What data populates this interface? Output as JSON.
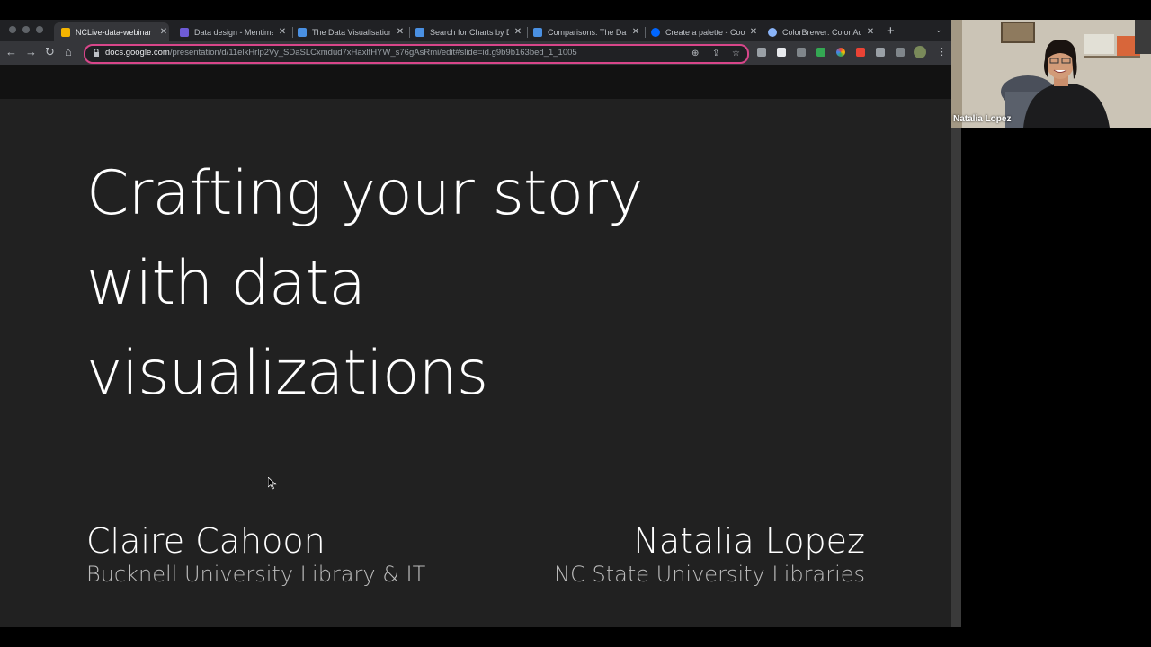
{
  "browser": {
    "tabs": [
      {
        "title": "NCLive-data-webinar",
        "favicon_color": "#f4b400",
        "active": true
      },
      {
        "title": "Data design - Mentimeter",
        "favicon_color": "#6e5bd6",
        "active": false
      },
      {
        "title": "The Data Visualisation Catalogue",
        "favicon_color": "#4a90e2",
        "active": false
      },
      {
        "title": "Search for Charts by Data",
        "favicon_color": "#4a90e2",
        "active": false
      },
      {
        "title": "Comparisons: The Data Viz",
        "favicon_color": "#4a90e2",
        "active": false
      },
      {
        "title": "Create a palette - Coolors",
        "favicon_color": "#0066ff",
        "active": false
      },
      {
        "title": "ColorBrewer: Color Advice",
        "favicon_color": "#8ab4f8",
        "active": false
      }
    ],
    "url_host": "docs.google.com",
    "url_path": "/presentation/d/11elkHrlp2Vy_SDaSLCxmdud7xHaxlfHYW_s76gAsRmi/edit#slide=id.g9b9b163bed_1_1005",
    "new_tab_symbol": "+",
    "icons": {
      "back": "←",
      "forward": "→",
      "reload": "↻",
      "home": "⌂",
      "zoom": "⊕",
      "share": "⇪",
      "bookmark": "☆",
      "close": "✕",
      "menu": "⌄"
    }
  },
  "slide": {
    "title_lines": [
      "Crafting your story",
      "with data",
      "visualizations"
    ],
    "presenters": [
      {
        "name": "Claire Cahoon",
        "org": "Bucknell University Library & IT"
      },
      {
        "name": "Natalia Lopez",
        "org": "NC State University Libraries"
      }
    ]
  },
  "webcam": {
    "participant_name": "Natalia Lopez"
  },
  "colors": {
    "accent_omnibox": "#d8468a",
    "slide_bg": "#212121"
  }
}
